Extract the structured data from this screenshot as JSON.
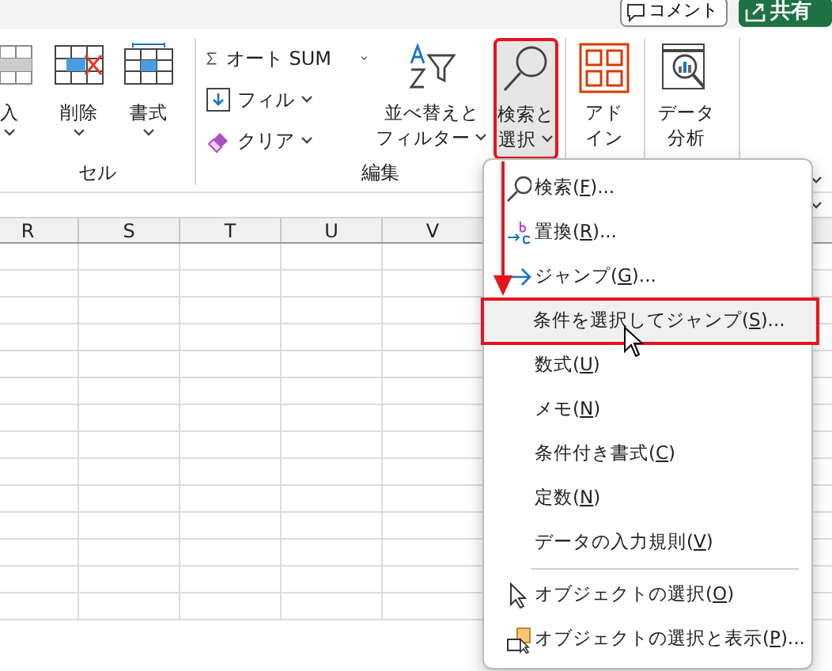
{
  "top_bar": {
    "comment_button": "コメント",
    "share_button": "共有"
  },
  "ribbon": {
    "groups": [
      {
        "label": "セル",
        "large_buttons": [
          {
            "label": [
              "入"
            ],
            "caret": true
          },
          {
            "label": [
              "削除"
            ],
            "caret": true
          },
          {
            "label": [
              "書式"
            ],
            "caret": true
          }
        ]
      },
      {
        "label": "編集",
        "small_buttons": [
          {
            "label": "オート SUM"
          },
          {
            "label": "フィル"
          },
          {
            "label": "クリア"
          }
        ],
        "large_buttons": [
          {
            "label": [
              "並べ替えと",
              "フィルター"
            ],
            "caret": true
          },
          {
            "label": [
              "検索と",
              "選択"
            ],
            "caret": true,
            "pressed": true,
            "highlighted": true
          }
        ]
      },
      {
        "large_buttons": [
          {
            "label": [
              "アド",
              "イン"
            ],
            "caret": false
          }
        ]
      },
      {
        "large_buttons": [
          {
            "label": [
              "データ",
              "分析"
            ],
            "caret": false
          }
        ]
      }
    ]
  },
  "sheet": {
    "columns": [
      "R",
      "S",
      "T",
      "U",
      "V"
    ]
  },
  "menu": {
    "items": [
      {
        "kind": "item",
        "before": "検索(",
        "key": "F",
        "after": ")...",
        "highlighted": false
      },
      {
        "kind": "item",
        "before": "置換(",
        "key": "R",
        "after": ")...",
        "highlighted": false
      },
      {
        "kind": "item",
        "before": "ジャンプ(",
        "key": "G",
        "after": ")...",
        "highlighted": false
      },
      {
        "kind": "item",
        "before": "条件を選択してジャンプ(",
        "key": "S",
        "after": ")...",
        "highlighted": true
      },
      {
        "kind": "item",
        "before": "数式(",
        "key": "U",
        "after": ")",
        "highlighted": false
      },
      {
        "kind": "item",
        "before": "メモ(",
        "key": "N",
        "after": ")",
        "highlighted": false
      },
      {
        "kind": "item",
        "before": "条件付き書式(",
        "key": "C",
        "after": ")",
        "highlighted": false
      },
      {
        "kind": "item",
        "before": "定数(",
        "key": "N",
        "after": ")",
        "highlighted": false
      },
      {
        "kind": "item",
        "before": "データの入力規則(",
        "key": "V",
        "after": ")",
        "highlighted": false
      },
      {
        "kind": "separator"
      },
      {
        "kind": "item",
        "before": "オブジェクトの選択(",
        "key": "O",
        "after": ")",
        "highlighted": false
      },
      {
        "kind": "item",
        "before": "オブジェクトの選択と表示(",
        "key": "P",
        "after": ")...",
        "highlighted": false
      }
    ]
  }
}
